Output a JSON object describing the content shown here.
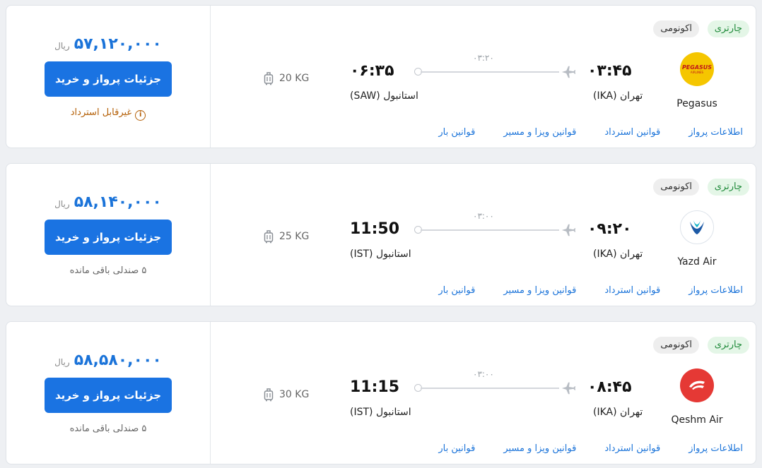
{
  "flights": [
    {
      "price": "۵۷,۱۲۰,۰۰۰",
      "currency": "ریال",
      "buy_label": "جزئیات پرواز و خرید",
      "note": "غیرقابل استرداد",
      "note_kind": "warning",
      "baggage": "20 KG",
      "arrival_time": "۰۶:۳۵",
      "arrival_city": "استانبول (SAW)",
      "departure_time": "۰۳:۴۵",
      "departure_city": "تهران (IKA)",
      "duration": "۰۳:۲۰",
      "airline_name": "Pegasus",
      "airline_logo_text": "PEGASUS",
      "airline_logo_subtext": "AIRLINES",
      "airline_color": "#f5c600",
      "flight_type": "چارتری",
      "cabin": "اکونومی",
      "links": [
        "اطلاعات پرواز",
        "قوانین استرداد",
        "قوانین ویزا و مسیر",
        "قوانین بار"
      ]
    },
    {
      "price": "۵۸,۱۴۰,۰۰۰",
      "currency": "ریال",
      "buy_label": "جزئیات پرواز و خرید",
      "note": "۵ صندلی باقی مانده",
      "note_kind": "info",
      "baggage": "25 KG",
      "arrival_time": "11:50",
      "arrival_city": "استانبول (IST)",
      "departure_time": "۰۹:۲۰",
      "departure_city": "تهران (IKA)",
      "duration": "۰۳:۰۰",
      "airline_name": "Yazd Air",
      "airline_color": "#1d5aa6",
      "flight_type": "چارتری",
      "cabin": "اکونومی",
      "links": [
        "اطلاعات پرواز",
        "قوانین استرداد",
        "قوانین ویزا و مسیر",
        "قوانین بار"
      ]
    },
    {
      "price": "۵۸,۵۸۰,۰۰۰",
      "currency": "ریال",
      "buy_label": "جزئیات پرواز و خرید",
      "note": "۵ صندلی باقی مانده",
      "note_kind": "info",
      "baggage": "30 KG",
      "arrival_time": "11:15",
      "arrival_city": "استانبول (IST)",
      "departure_time": "۰۸:۴۵",
      "departure_city": "تهران (IKA)",
      "duration": "۰۳:۰۰",
      "airline_name": "Qeshm Air",
      "airline_color": "#e53935",
      "flight_type": "چارتری",
      "cabin": "اکونومی",
      "links": [
        "اطلاعات پرواز",
        "قوانین استرداد",
        "قوانین ویزا و مسیر",
        "قوانین بار"
      ]
    }
  ]
}
